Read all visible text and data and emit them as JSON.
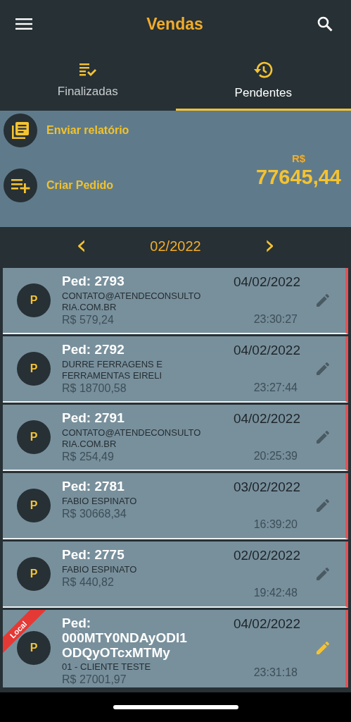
{
  "app_bar": {
    "title": "Vendas"
  },
  "tabs": [
    {
      "label": "Finalizadas",
      "selected": false
    },
    {
      "label": "Pendentes",
      "selected": true
    }
  ],
  "actions": [
    {
      "label": "Enviar relatório"
    },
    {
      "label": "Criar Pedido"
    }
  ],
  "total": {
    "currency": "R$",
    "value": "77645,44"
  },
  "month_nav": {
    "prev": "‹",
    "month": "02/2022",
    "next": "›"
  },
  "orders": [
    {
      "avatar": "P",
      "title": "Ped: 2793",
      "client": "CONTATO@ATENDECONSULTORIA.COM.BR",
      "amount": "R$ 579,24",
      "date": "04/02/2022",
      "time": "23:30:27",
      "local": false
    },
    {
      "avatar": "P",
      "title": "Ped: 2792",
      "client": "DURRE FERRAGENS E FERRAMENTAS EIRELI",
      "amount": "R$ 18700,58",
      "date": "04/02/2022",
      "time": "23:27:44",
      "local": false
    },
    {
      "avatar": "P",
      "title": "Ped: 2791",
      "client": "CONTATO@ATENDECONSULTORIA.COM.BR",
      "amount": "R$ 254,49",
      "date": "04/02/2022",
      "time": "20:25:39",
      "local": false
    },
    {
      "avatar": "P",
      "title": "Ped: 2781",
      "client": "FABIO ESPINATO",
      "amount": "R$ 30668,34",
      "date": "03/02/2022",
      "time": "16:39:20",
      "local": false
    },
    {
      "avatar": "P",
      "title": "Ped: 2775",
      "client": "FABIO ESPINATO",
      "amount": "R$ 440,82",
      "date": "02/02/2022",
      "time": "19:42:48",
      "local": false
    },
    {
      "avatar": "P",
      "title": "Ped: 000MTY0NDAyODI1ODQyOTcxMTMy",
      "client": "01 - CLIENTE TESTE",
      "amount": "R$ 27001,97",
      "date": "04/02/2022",
      "time": "23:31:18",
      "local": true,
      "ribbon": "Local"
    }
  ]
}
